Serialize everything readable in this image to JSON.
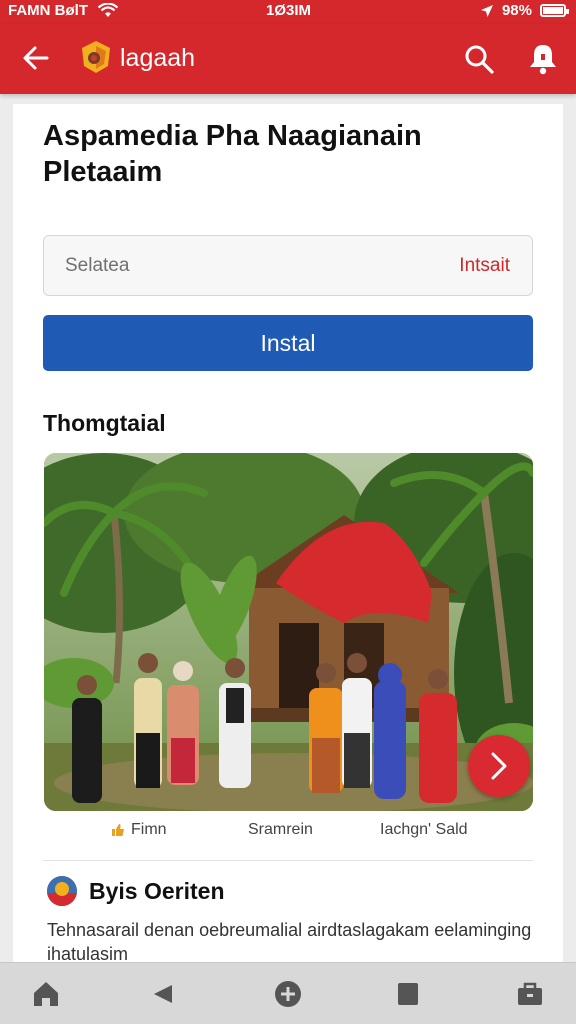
{
  "status_bar": {
    "carrier": "FAMN BølT",
    "time": "1Ø3IM",
    "battery": "98%",
    "battery_level": 0.9
  },
  "app_bar": {
    "title": "lagaah",
    "icons": [
      "back-arrow-icon",
      "app-logo-icon",
      "search-icon",
      "bell-icon"
    ]
  },
  "page": {
    "title": "Aspamedia Pha Naagianain Pletaaim",
    "input": {
      "placeholder": "Selatea",
      "action_label": "Intsait"
    },
    "primary_button": "Instal",
    "section_heading": "Thomgtaial",
    "photo": {
      "caption_items": [
        "Fimn",
        "Sramrein",
        "Iachgn' Sald"
      ]
    },
    "post": {
      "author": "Byis Oeriten",
      "body": "Tehnasarail denan oebreumalial airdtaslagakam eelaminging ihatulasim"
    }
  },
  "bottom_nav": {
    "items": [
      "home-icon",
      "back-icon",
      "add-icon",
      "square-icon",
      "briefcase-icon"
    ]
  },
  "colors": {
    "brand_red": "#d4282c",
    "primary_blue": "#1f5ab5",
    "accent_red_text": "#cc2a2a"
  }
}
